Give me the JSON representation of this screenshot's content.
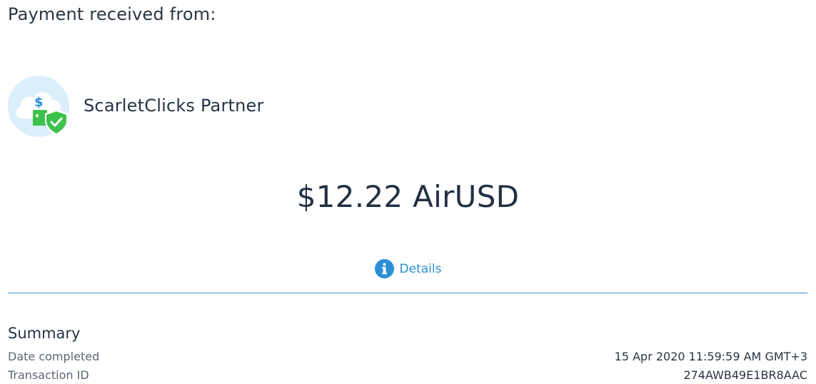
{
  "header": {
    "title": "Payment received from:"
  },
  "sender": {
    "name": "ScarletClicks Partner",
    "icon": "verified-payment-icon"
  },
  "payment": {
    "amount": "$12.22 AirUSD"
  },
  "details": {
    "label": "Details",
    "icon": "info-icon"
  },
  "summary": {
    "title": "Summary",
    "rows": [
      {
        "label": "Date completed",
        "value": "15 Apr 2020 11:59:59 AM GMT+3"
      },
      {
        "label": "Transaction ID",
        "value": "274AWB49E1BR8AAC"
      }
    ]
  },
  "colors": {
    "accent": "#2a8fd6",
    "divider": "#3b9ad9",
    "text": "#263445",
    "avatar_bg": "#dbeefb",
    "cloud": "#ffffff",
    "shield": "#3cc24a",
    "dollar": "#2a8fd6"
  }
}
